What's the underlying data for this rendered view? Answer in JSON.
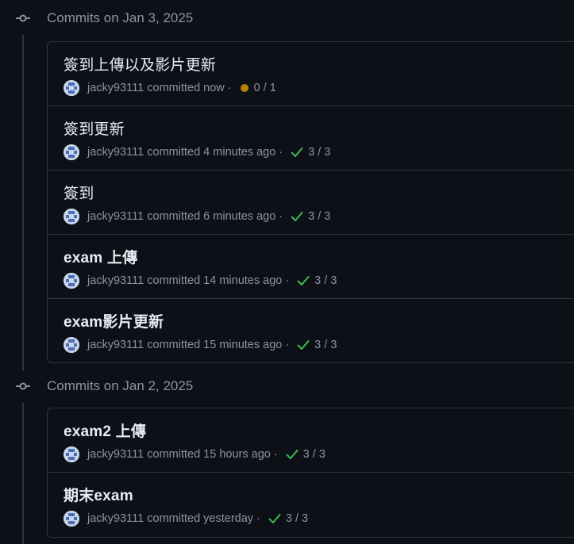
{
  "groups": [
    {
      "title": "Commits on Jan 3, 2025",
      "commits": [
        {
          "title": "簽到上傳以及影片更新",
          "author": "jacky93111",
          "action": "committed",
          "time": "now",
          "status": "pending",
          "status_icon": "dot-pending-icon",
          "checks": "0 / 1"
        },
        {
          "title": "簽到更新",
          "author": "jacky93111",
          "action": "committed",
          "time": "4 minutes ago",
          "status": "success",
          "status_icon": "check-icon",
          "checks": "3 / 3"
        },
        {
          "title": "簽到",
          "author": "jacky93111",
          "action": "committed",
          "time": "6 minutes ago",
          "status": "success",
          "status_icon": "check-icon",
          "checks": "3 / 3"
        },
        {
          "title": "exam 上傳",
          "author": "jacky93111",
          "action": "committed",
          "time": "14 minutes ago",
          "status": "success",
          "status_icon": "check-icon",
          "checks": "3 / 3"
        },
        {
          "title": "exam影片更新",
          "author": "jacky93111",
          "action": "committed",
          "time": "15 minutes ago",
          "status": "success",
          "status_icon": "check-icon",
          "checks": "3 / 3"
        }
      ]
    },
    {
      "title": "Commits on Jan 2, 2025",
      "commits": [
        {
          "title": "exam2 上傳",
          "author": "jacky93111",
          "action": "committed",
          "time": "15 hours ago",
          "status": "success",
          "status_icon": "check-icon",
          "checks": "3 / 3"
        },
        {
          "title": "期末exam",
          "author": "jacky93111",
          "action": "committed",
          "time": "yesterday",
          "status": "success",
          "status_icon": "check-icon",
          "checks": "3 / 3"
        }
      ]
    }
  ],
  "colors": {
    "background": "#0d1117",
    "border": "#30363d",
    "muted_text": "#8b949e",
    "primary_text": "#e6edf3",
    "success": "#3fb950",
    "pending": "#bb8009"
  }
}
